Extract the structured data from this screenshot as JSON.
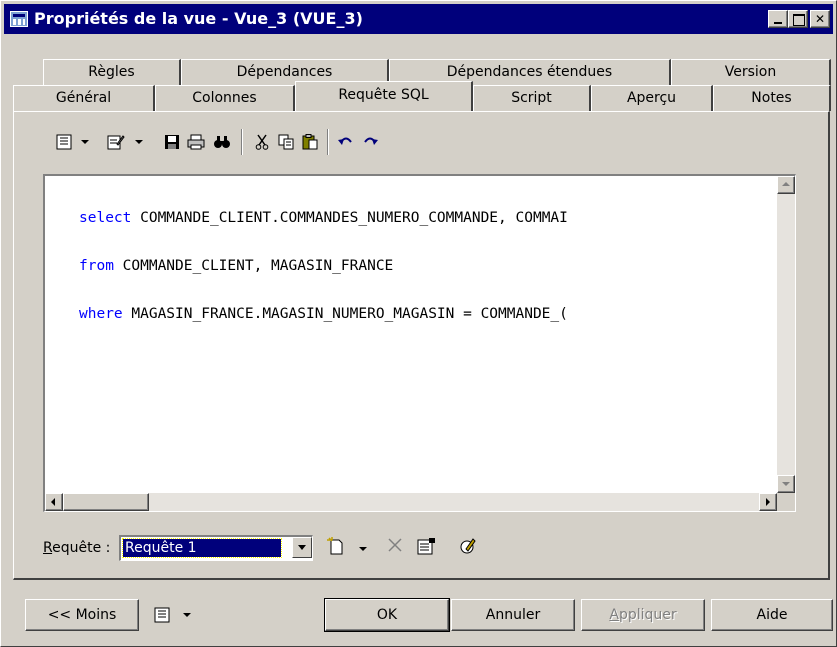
{
  "window": {
    "title": "Propriétés de la vue - Vue_3 (VUE_3)"
  },
  "tabs": {
    "row_back": [
      {
        "label": "Règles"
      },
      {
        "label": "Dépendances"
      },
      {
        "label": "Dépendances étendues"
      },
      {
        "label": "Version"
      }
    ],
    "row_front": [
      {
        "label": "Général"
      },
      {
        "label": "Colonnes"
      },
      {
        "label": "Requête SQL"
      },
      {
        "label": "Script"
      },
      {
        "label": "Aperçu"
      },
      {
        "label": "Notes"
      }
    ],
    "active": "Requête SQL"
  },
  "toolbar": {
    "icons": [
      "properties-icon",
      "edit-icon",
      "save-icon",
      "print-icon",
      "find-icon",
      "cut-icon",
      "copy-icon",
      "paste-icon",
      "undo-icon",
      "redo-icon"
    ]
  },
  "editor": {
    "lines": [
      {
        "keyword": "select",
        "rest": " COMMANDE_CLIENT.COMMANDES_NUMERO_COMMANDE, COMMAI"
      },
      {
        "keyword": "from",
        "rest": " COMMANDE_CLIENT, MAGASIN_FRANCE"
      },
      {
        "keyword": "where",
        "rest": " MAGASIN_FRANCE.MAGASIN_NUMERO_MAGASIN = COMMANDE_("
      }
    ],
    "keyword_color": "#0000ff"
  },
  "query": {
    "label_underlined": "R",
    "label_rest": "equête :",
    "selected": "Requête 1"
  },
  "buttons": {
    "less": "<< Moins",
    "ok": "OK",
    "cancel": "Annuler",
    "apply_underlined": "A",
    "apply_rest": "ppliquer",
    "help": "Aide"
  },
  "colors": {
    "titlebar": "#00007b",
    "face": "#d4d0c8",
    "selection": "#00007b"
  }
}
